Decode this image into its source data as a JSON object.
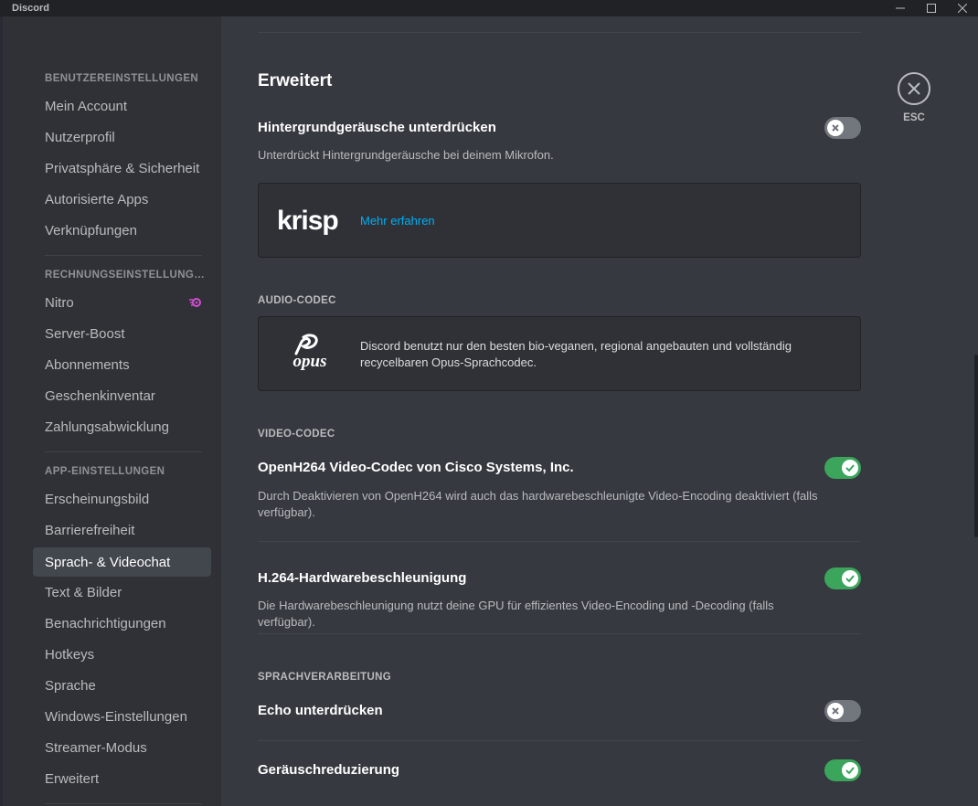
{
  "window": {
    "title": "Discord"
  },
  "sidebar": {
    "sections": [
      {
        "header": "BENUTZEREINSTELLUNGEN",
        "items": [
          "Mein Account",
          "Nutzerprofil",
          "Privatsphäre & Sicherheit",
          "Autorisierte Apps",
          "Verknüpfungen"
        ]
      },
      {
        "header": "RECHNUNGSEINSTELLUNGEN",
        "items": [
          "Nitro",
          "Server-Boost",
          "Abonnements",
          "Geschenkinventar",
          "Zahlungsabwicklung"
        ]
      },
      {
        "header": "APP-EINSTELLUNGEN",
        "items": [
          "Erscheinungsbild",
          "Barrierefreiheit",
          "Sprach- & Videochat",
          "Text & Bilder",
          "Benachrichtigungen",
          "Hotkeys",
          "Sprache",
          "Windows-Einstellungen",
          "Streamer-Modus",
          "Erweitert"
        ]
      }
    ],
    "selected": "Sprach- & Videochat",
    "nitro_icon_color": "#d14fd1"
  },
  "main": {
    "section_title": "Erweitert",
    "noise_suppression": {
      "title": "Hintergrundgeräusche unterdrücken",
      "description": "Unterdrückt Hintergrundgeräusche bei deinem Mikrofon.",
      "enabled": false
    },
    "krisp": {
      "logo": "krisp",
      "link": "Mehr erfahren"
    },
    "audio_codec": {
      "header": "AUDIO-CODEC",
      "logo": "opus",
      "text": "Discord benutzt nur den besten bio-veganen, regional angebauten und vollständig recycelbaren Opus-Sprachcodec."
    },
    "video_codec": {
      "header": "VIDEO-CODEC",
      "openh264": {
        "title": "OpenH264 Video-Codec von Cisco Systems, Inc.",
        "description": "Durch Deaktivieren von OpenH264 wird auch das hardwarebeschleunigte Video-Encoding deaktiviert (falls verfügbar).",
        "enabled": true
      },
      "hw_accel": {
        "title": "H.264-Hardwarebeschleunigung",
        "description": "Die Hardwarebeschleunigung nutzt deine GPU für effizientes Video-Encoding und -Decoding (falls verfügbar).",
        "enabled": true
      }
    },
    "voice_processing": {
      "header": "SPRACHVERARBEITUNG",
      "echo": {
        "title": "Echo unterdrücken",
        "enabled": false
      },
      "noise_reduction": {
        "title": "Geräuschreduzierung",
        "enabled": true
      }
    }
  },
  "close": {
    "label": "ESC"
  },
  "colors": {
    "accent_green": "#3ba55c",
    "link_blue": "#00aff4",
    "toggle_off": "#72767d"
  }
}
